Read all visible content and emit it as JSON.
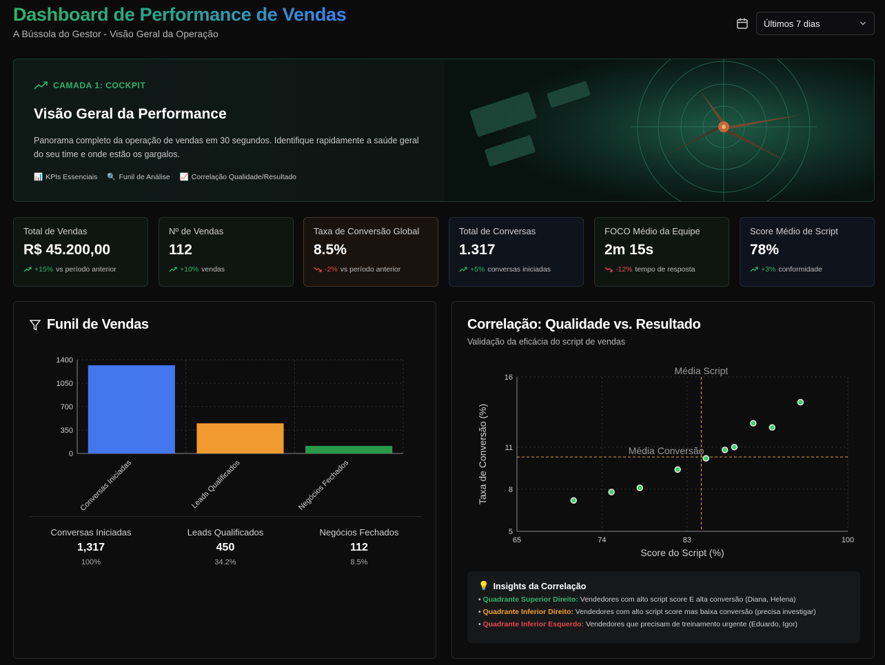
{
  "header": {
    "title": "Dashboard de Performance de Vendas",
    "subtitle": "A Bússola do Gestor - Visão Geral da Operação",
    "period_selected": "Últimos 7 dias"
  },
  "hero": {
    "tag": "CAMADA 1: COCKPIT",
    "title": "Visão Geral da Performance",
    "description": "Panorama completo da operação de vendas em 30 segundos. Identifique rapidamente a saúde geral do seu time e onde estão os gargalos.",
    "pills": [
      {
        "icon": "📊",
        "label": "KPIs Essenciais"
      },
      {
        "icon": "🔍",
        "label": "Funil de Análise"
      },
      {
        "icon": "📈",
        "label": "Correlação Qualidade/Resultado"
      }
    ]
  },
  "kpis": [
    {
      "label": "Total de Vendas",
      "value": "R$ 45.200,00",
      "delta": "+15%",
      "delta_text": "vs período anterior",
      "trend": "up"
    },
    {
      "label": "Nº de Vendas",
      "value": "112",
      "delta": "+10%",
      "delta_text": "vendas",
      "trend": "up"
    },
    {
      "label": "Taxa de Conversão Global",
      "value": "8.5%",
      "delta": "-2%",
      "delta_text": "vs período anterior",
      "trend": "down"
    },
    {
      "label": "Total de Conversas",
      "value": "1.317",
      "delta": "+5%",
      "delta_text": "conversas iniciadas",
      "trend": "up"
    },
    {
      "label": "FOCO Médio da Equipe",
      "value": "2m 15s",
      "delta": "-12%",
      "delta_text": "tempo de resposta",
      "trend": "down"
    },
    {
      "label": "Score Médio de Script",
      "value": "78%",
      "delta": "+3%",
      "delta_text": "conformidade",
      "trend": "up"
    }
  ],
  "funnel": {
    "title": "Funil de Vendas",
    "stats": [
      {
        "name": "Conversas Iniciadas",
        "value": "1,317",
        "pct": "100%"
      },
      {
        "name": "Leads Qualificados",
        "value": "450",
        "pct": "34.2%"
      },
      {
        "name": "Negócios Fechados",
        "value": "112",
        "pct": "8.5%"
      }
    ]
  },
  "correlation": {
    "title": "Correlação: Qualidade vs. Resultado",
    "subtitle": "Validação da eficácia do script de vendas",
    "insights_title": "Insights da Correlação",
    "insights": [
      {
        "label": "Quadrante Superior Direito:",
        "text": "Vendedores com alto script score E alta conversão (Diana, Helena)",
        "color": "#2fb36a"
      },
      {
        "label": "Quadrante Inferior Direito:",
        "text": "Vendedores com alto script score mas baixa conversão (precisa investigar)",
        "color": "#f0a030"
      },
      {
        "label": "Quadrante Inferior Esquerdo:",
        "text": "Vendedores que precisam de treinamento urgente (Eduardo, Igor)",
        "color": "#e5484d"
      }
    ]
  },
  "chart_data": [
    {
      "type": "bar",
      "categories": [
        "Conversas Iniciadas",
        "Leads Qualificados",
        "Negócios Fechados"
      ],
      "values": [
        1317,
        450,
        112
      ],
      "colors": [
        "#4477ee",
        "#f09a30",
        "#2a9a48"
      ],
      "ylim": [
        0,
        1400
      ],
      "yticks": [
        0,
        350,
        700,
        1050,
        1400
      ]
    },
    {
      "type": "scatter",
      "xlabel": "Score do Script (%)",
      "ylabel": "Taxa de Conversão (%)",
      "xlim": [
        65,
        100
      ],
      "ylim": [
        5,
        16
      ],
      "xticks": [
        65,
        74,
        83,
        100
      ],
      "yticks": [
        5,
        8,
        11,
        16
      ],
      "points": [
        {
          "x": 71,
          "y": 7.2
        },
        {
          "x": 75,
          "y": 7.8
        },
        {
          "x": 78,
          "y": 8.1
        },
        {
          "x": 82,
          "y": 9.4
        },
        {
          "x": 85,
          "y": 10.2
        },
        {
          "x": 87,
          "y": 10.8
        },
        {
          "x": 88,
          "y": 11.0
        },
        {
          "x": 90,
          "y": 12.7
        },
        {
          "x": 92,
          "y": 12.4
        },
        {
          "x": 95,
          "y": 14.2
        }
      ],
      "reference_lines": [
        {
          "axis": "x",
          "value": 84.5,
          "label": "Média Script"
        },
        {
          "axis": "y",
          "value": 10.3,
          "label": "Média Conversão"
        }
      ]
    }
  ]
}
